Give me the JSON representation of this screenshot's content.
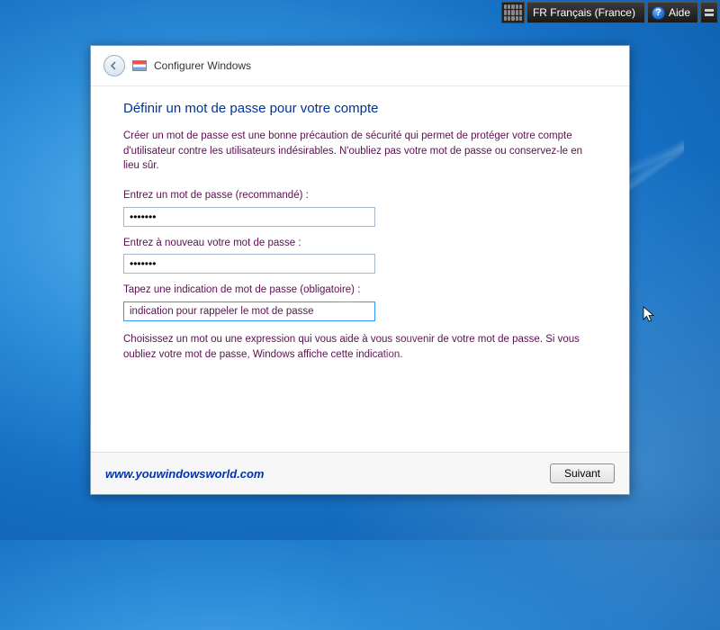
{
  "toolbar": {
    "language_label": "FR Français (France)",
    "help_label": "Aide"
  },
  "window": {
    "header_title": "Configurer Windows"
  },
  "main": {
    "title": "Définir un mot de passe pour votre compte",
    "intro": "Créer un mot de passe est une bonne précaution de sécurité qui permet de protéger votre compte d'utilisateur contre les utilisateurs indésirables. N'oubliez pas votre mot de passe ou conservez-le en lieu sûr.",
    "password_label": "Entrez un mot de passe (recommandé) :",
    "password_value": "•••••••",
    "confirm_label": "Entrez à nouveau votre mot de passe :",
    "confirm_value": "•••••••",
    "hint_label": "Tapez une indication de mot de passe (obligatoire) :",
    "hint_value": "indication pour rappeler le mot de passe",
    "hint_explanation": "Choisissez un mot ou une expression qui vous aide à vous souvenir de votre mot de passe. Si vous oubliez votre mot de passe, Windows affiche cette indication."
  },
  "footer": {
    "watermark": "www.youwindowsworld.com",
    "next_label": "Suivant"
  }
}
